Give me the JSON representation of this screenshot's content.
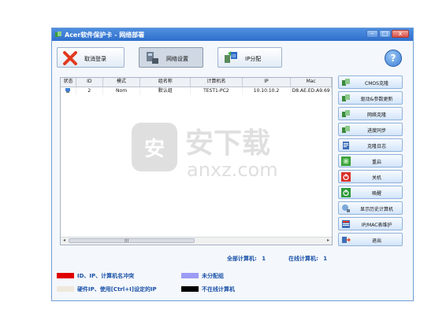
{
  "window": {
    "title": "Acer软件保护卡 - 网络部署"
  },
  "toolbar": {
    "cancel_login": "取消登录",
    "network_settings": "网络设置",
    "ip_assign": "IP分配"
  },
  "table": {
    "columns": [
      "状态",
      "ID",
      "模式",
      "组名称",
      "计算机名",
      "IP",
      "Mac"
    ],
    "rows": [
      {
        "status": "",
        "id": "2",
        "mode": "Nom",
        "group": "默认组",
        "name": "TEST1-PC2",
        "ip": "10.10.10.2",
        "mac": "D8.AE.ED.A9.69"
      }
    ]
  },
  "side_buttons": [
    "CMOS克隆",
    "驱动&参数更新",
    "网络克隆",
    "进度同步",
    "克隆日志",
    "重启",
    "关机",
    "唤醒",
    "显示历史计算机",
    "IP/MAC表维护",
    "退出"
  ],
  "stats": {
    "total_label": "全部计算机:",
    "total_value": "1",
    "online_label": "在线计算机:",
    "online_value": "1"
  },
  "legend": {
    "conflict": "ID、IP、计算机名冲突",
    "unassigned": "未分配组",
    "hardware_ip": "硬件IP、使用[Ctrl+I]设定的IP",
    "offline": "不在线计算机",
    "colors": {
      "conflict": "#e00000",
      "unassigned": "#9c9cf4",
      "hardware_ip": "#efe9dc",
      "offline": "#000000"
    }
  },
  "watermark": {
    "text": "安下载",
    "sub": "anxz.com"
  }
}
